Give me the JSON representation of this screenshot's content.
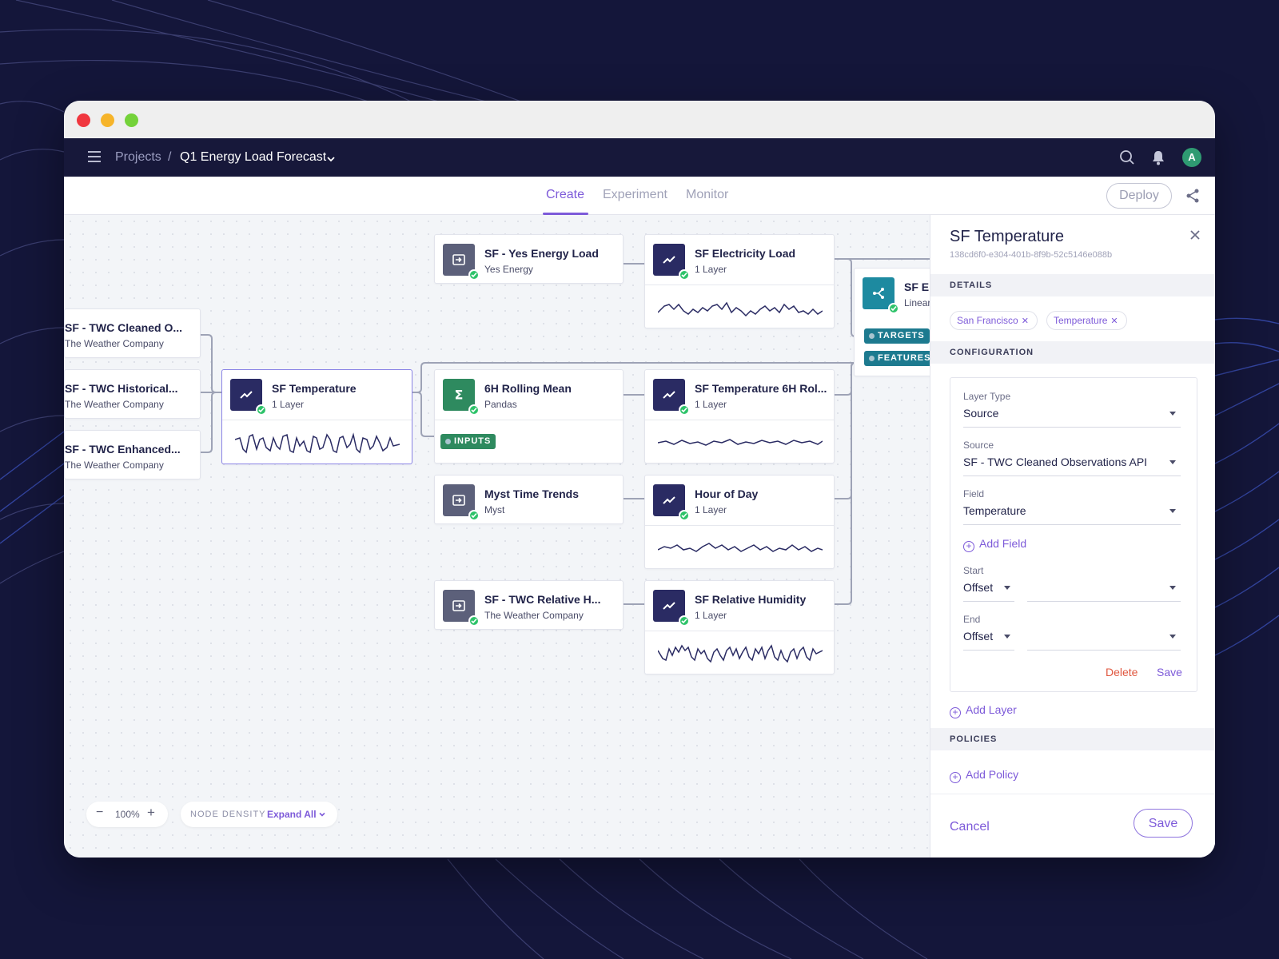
{
  "window": {
    "controls": [
      "close",
      "minimize",
      "maximize"
    ]
  },
  "nav": {
    "breadcrumb_root": "Projects",
    "breadcrumb_sep": "/",
    "project_name": "Q1 Energy Load Forecast",
    "avatar_initial": "A",
    "icons": [
      "menu-icon",
      "search-icon",
      "bell-icon"
    ]
  },
  "tabs": [
    {
      "label": "Create",
      "active": true
    },
    {
      "label": "Experiment",
      "active": false
    },
    {
      "label": "Monitor",
      "active": false
    }
  ],
  "deploy_label": "Deploy",
  "canvas": {
    "nodes": {
      "twc_cleaned": {
        "title": "SF - TWC Cleaned O...",
        "sub": "The Weather Company",
        "status": "ok"
      },
      "twc_historical": {
        "title": "SF - TWC Historical...",
        "sub": "The Weather Company",
        "status": "ok"
      },
      "twc_enhanced": {
        "title": "SF - TWC Enhanced...",
        "sub": "The Weather Company",
        "status": "ok"
      },
      "sf_temperature": {
        "title": "SF Temperature",
        "sub": "1 Layer",
        "status": "ok",
        "selected": true
      },
      "yes_energy_load": {
        "title": "SF - Yes Energy Load",
        "sub": "Yes Energy",
        "status": "ok"
      },
      "electricity_load": {
        "title": "SF Electricity Load",
        "sub": "1 Layer",
        "status": "ok"
      },
      "model": {
        "title": "SF El",
        "sub": "Linear",
        "status": "ok"
      },
      "rolling_mean": {
        "title": "6H Rolling Mean",
        "sub": "Pandas",
        "status": "ok"
      },
      "temp_6h_roll": {
        "title": "SF Temperature 6H Rol...",
        "sub": "1 Layer",
        "status": "ok"
      },
      "myst_time_trends": {
        "title": "Myst Time Trends",
        "sub": "Myst",
        "status": "ok"
      },
      "hour_of_day": {
        "title": "Hour of Day",
        "sub": "1 Layer",
        "status": "ok"
      },
      "twc_relative_h": {
        "title": "SF - TWC Relative H...",
        "sub": "The Weather Company",
        "status": "ok"
      },
      "relative_humidity": {
        "title": "SF Relative Humidity",
        "sub": "1 Layer",
        "status": "ok"
      }
    },
    "ports": {
      "inputs": "INPUTS",
      "targets": "TARGETS",
      "features": "FEATURES"
    },
    "zoom": "100%",
    "zoom_minus": "−",
    "zoom_plus": "+",
    "density_label": "NODE DENSITY",
    "density_value": "Expand All"
  },
  "panel": {
    "title": "SF Temperature",
    "id": "138cd6f0-e304-401b-8f9b-52c5146e088b",
    "details_label": "DETAILS",
    "tags": [
      "San Francisco",
      "Temperature"
    ],
    "configuration_label": "CONFIGURATION",
    "layer_type": {
      "label": "Layer Type",
      "value": "Source"
    },
    "source": {
      "label": "Source",
      "value": "SF - TWC Cleaned Observations API"
    },
    "field": {
      "label": "Field",
      "value": "Temperature"
    },
    "add_field": "Add Field",
    "start": {
      "label": "Start",
      "value": "Offset"
    },
    "end": {
      "label": "End",
      "value": "Offset"
    },
    "delete": "Delete",
    "save_layer": "Save",
    "add_layer": "Add Layer",
    "policies_label": "POLICIES",
    "add_policy": "Add Policy",
    "cancel": "Cancel",
    "save": "Save"
  },
  "colors": {
    "background": "#14163a",
    "accent": "#7d5ad9",
    "navy_icon": "#2a2b63",
    "success": "#2ec36a",
    "danger": "#e0573f"
  }
}
